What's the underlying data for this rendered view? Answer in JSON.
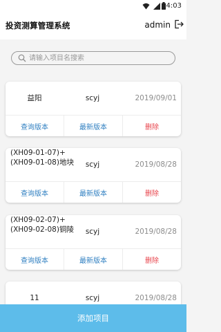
{
  "status": {
    "time": "4:03"
  },
  "app": {
    "title": "投资测算管理系统",
    "username": "admin"
  },
  "search": {
    "placeholder": "请输入项目名搜索",
    "value": ""
  },
  "actions": {
    "query": "查询版本",
    "latest": "最新版本",
    "delete": "删除"
  },
  "projects": [
    {
      "name": "益阳",
      "user": "scyj",
      "date": "2019/09/01"
    },
    {
      "name": "(XH09-01-07)+(XH09-01-08)地块",
      "name_line1": "(XH09-01-07)+",
      "name_line2": "(XH09-01-08)地块",
      "user": "scyj",
      "date": "2019/08/28"
    },
    {
      "name": "(XH09-02-07)+(XH09-02-08)铜陵",
      "name_line1": "(XH09-02-07)+",
      "name_line2": "(XH09-02-08)铜陵",
      "user": "scyj",
      "date": "2019/08/28"
    },
    {
      "name": "11",
      "user": "scyj",
      "date": "2019/08/28"
    }
  ],
  "add_button": {
    "label": "添加项目"
  },
  "colors": {
    "accent": "#5dbcea",
    "link": "#2f7fc1",
    "danger": "#e8454d"
  },
  "icons": {
    "status": [
      "wifi-icon",
      "signal-icon",
      "battery-icon"
    ],
    "logout": "logout-icon",
    "search": "search-icon"
  }
}
